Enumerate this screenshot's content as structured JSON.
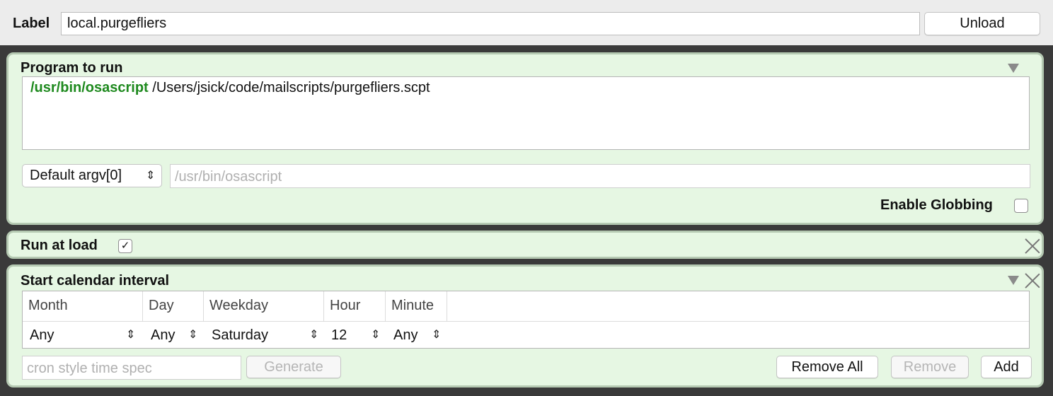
{
  "header": {
    "label_title": "Label",
    "label_value": "local.purgefliers",
    "unload_button": "Unload"
  },
  "program_panel": {
    "title": "Program to run",
    "exec_path": "/usr/bin/osascript",
    "args": " /Users/jsick/code/mailscripts/purgefliers.scpt",
    "argv_popup": "Default argv[0]",
    "argv_placeholder": "/usr/bin/osascript",
    "globbing_label": "Enable Globbing",
    "globbing_checked": false
  },
  "run_at_load_panel": {
    "title": "Run at load",
    "checked": true
  },
  "calendar_panel": {
    "title": "Start calendar interval",
    "columns": [
      "Month",
      "Day",
      "Weekday",
      "Hour",
      "Minute"
    ],
    "values": [
      "Any",
      "Any",
      "Saturday",
      "12",
      "Any"
    ],
    "cron_placeholder": "cron style time spec",
    "generate_button": "Generate",
    "remove_all_button": "Remove All",
    "remove_button": "Remove",
    "add_button": "Add"
  },
  "icons": {
    "updown": "chevron-updown-icon",
    "collapse": "disclosure-triangle-icon",
    "close": "close-icon"
  },
  "colors": {
    "panel_bg": "#e6f7e3",
    "exec_green": "#1f8a1f"
  }
}
